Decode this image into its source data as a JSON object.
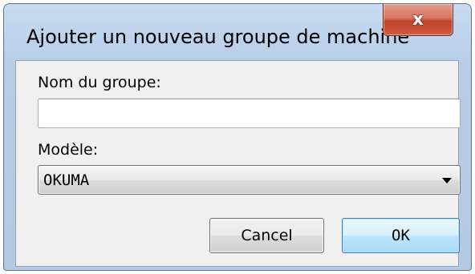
{
  "window": {
    "title": "Ajouter un nouveau groupe de machine",
    "close_glyph": "x",
    "close_icon": "close-icon"
  },
  "form": {
    "group_name_label": "Nom du groupe:",
    "group_name_value": "",
    "model_label": "Modèle:",
    "model_selected": "OKUMA",
    "model_arrow_icon": "chevron-down-icon"
  },
  "buttons": {
    "cancel_label": "Cancel",
    "ok_label": "OK"
  },
  "colors": {
    "title_bar": "#bcd3ec",
    "client_bg": "#f0f0f0",
    "close_button": "#c8452e",
    "ok_button_accent": "#3c7fb1"
  }
}
